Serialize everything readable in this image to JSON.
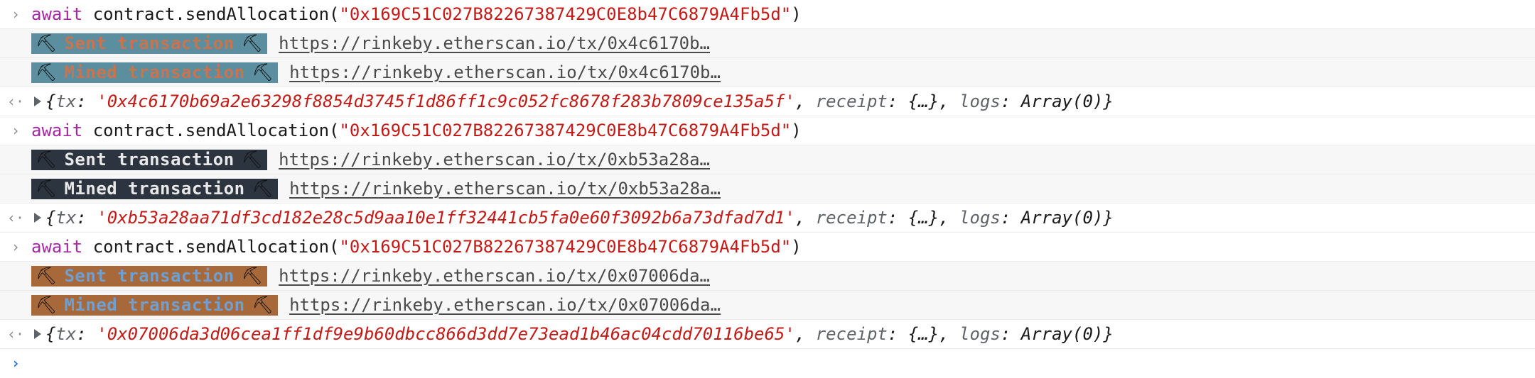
{
  "icons": {
    "input_prompt": "chevron-right-icon",
    "result_marker": "return-arrow-icon",
    "expand": "triangle-right-icon",
    "pickaxe": "pickaxe-icon"
  },
  "glyphs": {
    "input_prompt": "›",
    "result_marker": "‹·",
    "pickaxe": "⛏",
    "active_prompt": "›"
  },
  "colors": {
    "keyword": "#a626a4",
    "string": "#c41a16",
    "active_prompt": "#1a73e8"
  },
  "entries": [
    {
      "command": {
        "keyword": "await",
        "call": "contract.sendAllocation(",
        "arg": "\"0x169C51C027B82267387429C0E8b47C6879A4Fb5d\"",
        "close": ")"
      },
      "logs": [
        {
          "label": "Sent transaction",
          "url": "https://rinkeby.etherscan.io/tx/0x4c6170b…",
          "bg": "#5b8fa0",
          "fg": "#c8744e"
        },
        {
          "label": "Mined transaction",
          "url": "https://rinkeby.etherscan.io/tx/0x4c6170b…",
          "bg": "#5b8fa0",
          "fg": "#c8744e"
        }
      ],
      "result": {
        "open": "{",
        "tx_key": "tx",
        "tx_value": "'0x4c6170b69a2e63298f8854d3745f1d86ff1c9c052fc8678f283b7809ce135a5f'",
        "receipt_key": "receipt",
        "receipt_value": "{…}",
        "logs_key": "logs",
        "logs_value": "Array(0)",
        "close": "}"
      }
    },
    {
      "command": {
        "keyword": "await",
        "call": "contract.sendAllocation(",
        "arg": "\"0x169C51C027B82267387429C0E8b47C6879A4Fb5d\"",
        "close": ")"
      },
      "logs": [
        {
          "label": "Sent transaction",
          "url": "https://rinkeby.etherscan.io/tx/0xb53a28a…",
          "bg": "#2c3440",
          "fg": "#e8e8e8"
        },
        {
          "label": "Mined transaction",
          "url": "https://rinkeby.etherscan.io/tx/0xb53a28a…",
          "bg": "#2c3440",
          "fg": "#e8e8e8"
        }
      ],
      "result": {
        "open": "{",
        "tx_key": "tx",
        "tx_value": "'0xb53a28aa71df3cd182e28c5d9aa10e1ff32441cb5fa0e60f3092b6a73dfad7d1'",
        "receipt_key": "receipt",
        "receipt_value": "{…}",
        "logs_key": "logs",
        "logs_value": "Array(0)",
        "close": "}"
      }
    },
    {
      "command": {
        "keyword": "await",
        "call": "contract.sendAllocation(",
        "arg": "\"0x169C51C027B82267387429C0E8b47C6879A4Fb5d\"",
        "close": ")"
      },
      "logs": [
        {
          "label": "Sent transaction",
          "url": "https://rinkeby.etherscan.io/tx/0x07006da…",
          "bg": "#a8693a",
          "fg": "#6f9fd0"
        },
        {
          "label": "Mined transaction",
          "url": "https://rinkeby.etherscan.io/tx/0x07006da…",
          "bg": "#a8693a",
          "fg": "#6f9fd0"
        }
      ],
      "result": {
        "open": "{",
        "tx_key": "tx",
        "tx_value": "'0x07006da3d06cea1ff1df9e9b60dbcc866d3dd7e73ead1b46ac04cdd70116be65'",
        "receipt_key": "receipt",
        "receipt_value": "{…}",
        "logs_key": "logs",
        "logs_value": "Array(0)",
        "close": "}"
      }
    }
  ]
}
